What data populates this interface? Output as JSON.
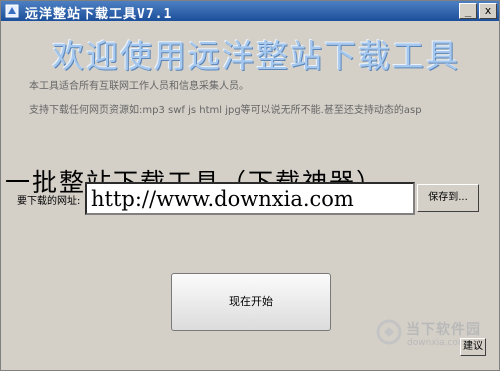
{
  "window": {
    "title": "远洋整站下载工具V7.1",
    "minimize_symbol": "_",
    "close_symbol": "x"
  },
  "header": {
    "big_title": "欢迎使用远洋整站下载工具"
  },
  "notes": [
    "本工具适合所有互联网工作人员和信息采集人员。",
    "支持下载任何网页资源如:mp3 swf js html jpg等可以说无所不能.甚至还支持动态的asp"
  ],
  "overlay_caption": "一批整站下载工具（下载神器）",
  "form": {
    "url_label": "要下载的网址:",
    "url_value": "http://www.downxia.com",
    "save_label": "保存到..."
  },
  "actions": {
    "start_label": "现在开始",
    "help_label": "建议"
  },
  "watermark": {
    "brand": "当下软件园",
    "site": "downxia.com"
  },
  "icons": {
    "app": "app-icon",
    "watermark": "watermark-logo-icon"
  },
  "colors": {
    "titlebar": "#2a5ca8",
    "window_bg": "#d4d0c8",
    "big_title": "#a6c8ee"
  }
}
